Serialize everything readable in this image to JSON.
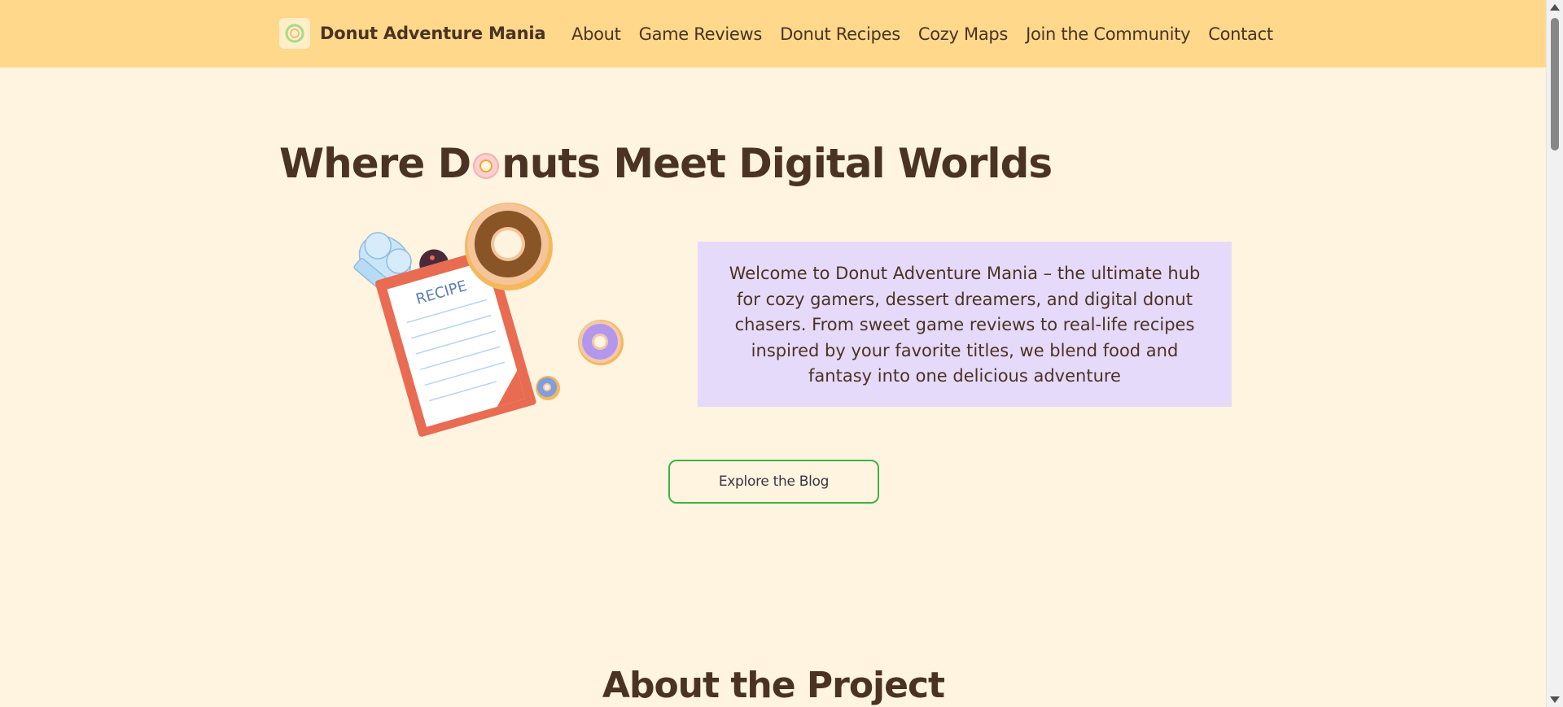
{
  "site": {
    "brand_name": "Donut Adventure Mania",
    "logo_icon": "donut-logo-icon"
  },
  "nav": {
    "items": [
      {
        "label": "About"
      },
      {
        "label": "Game Reviews"
      },
      {
        "label": "Donut Recipes"
      },
      {
        "label": "Cozy Maps"
      },
      {
        "label": "Join the Community"
      },
      {
        "label": "Contact"
      }
    ]
  },
  "hero": {
    "title_part1": "Where D",
    "title_part2": "nuts Meet Digital Worlds",
    "illustration_text": "RECIPE",
    "welcome_text": "Welcome to Donut Adventure Mania – the ultimate hub for cozy gamers, dessert dreamers, and digital donut chasers. From sweet game reviews to real-life recipes inspired by your favorite titles, we blend food and fantasy into one delicious adventure",
    "button_label": "Explore the Blog"
  },
  "about": {
    "title": "About the Project"
  },
  "colors": {
    "header_bg": "#ffd88c",
    "page_bg": "#fff4df",
    "text": "#4a3322",
    "welcome_bg": "#e5dafa",
    "button_border": "#3cb34a"
  }
}
